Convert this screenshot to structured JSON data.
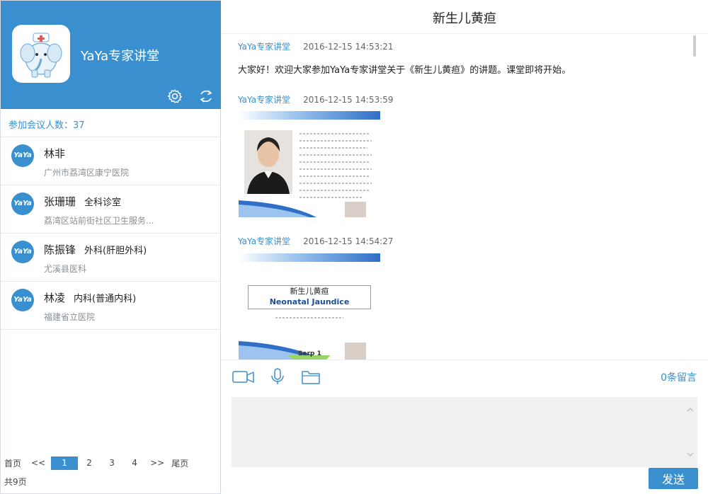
{
  "app": {
    "title": "YaYa专家讲堂",
    "accent": "#3a8fcf"
  },
  "sidebar": {
    "participants_label": "参加会议人数：37",
    "avatar_text": "YaYa",
    "members": [
      {
        "name": "林非",
        "dept": "",
        "org": "广州市荔湾区康宁医院"
      },
      {
        "name": "张珊珊",
        "dept": "全科诊室",
        "org": "荔湾区站前街社区卫生服务..."
      },
      {
        "name": "陈振锋",
        "dept": "外科(肝胆外科)",
        "org": "尤溪县医科"
      },
      {
        "name": "林凌",
        "dept": "内科(普通内科)",
        "org": "福建省立医院"
      }
    ],
    "pager": {
      "first": "首页",
      "prev": "<<",
      "pages": [
        "1",
        "2",
        "3",
        "4"
      ],
      "current": "1",
      "next": ">>",
      "last": "尾页",
      "total": "共9页"
    },
    "icons": [
      "gear-icon",
      "refresh-icon"
    ]
  },
  "main": {
    "topic": "新生儿黄疸",
    "messages": [
      {
        "sender": "YaYa专家讲堂",
        "time": "2016-12-15 14:53:21",
        "text": "大家好！欢迎大家参加YaYa专家讲堂关于《新生儿黄疸》的讲题。课堂即将开始。"
      },
      {
        "sender": "YaYa专家讲堂",
        "time": "2016-12-15 14:53:59",
        "image": "slide-speaker-intro"
      },
      {
        "sender": "YaYa专家讲堂",
        "time": "2016-12-15 14:54:27",
        "image": "slide-title",
        "slide_title_cn": "新生儿黄疸",
        "slide_title_en": "Neonatal Jaundice",
        "slide_footer": "Serp 1"
      }
    ],
    "toolbar": {
      "icons": [
        "video-icon",
        "microphone-icon",
        "folder-icon"
      ],
      "message_count": "0条留言"
    },
    "input": {
      "placeholder": ""
    },
    "send_label": "发送"
  }
}
